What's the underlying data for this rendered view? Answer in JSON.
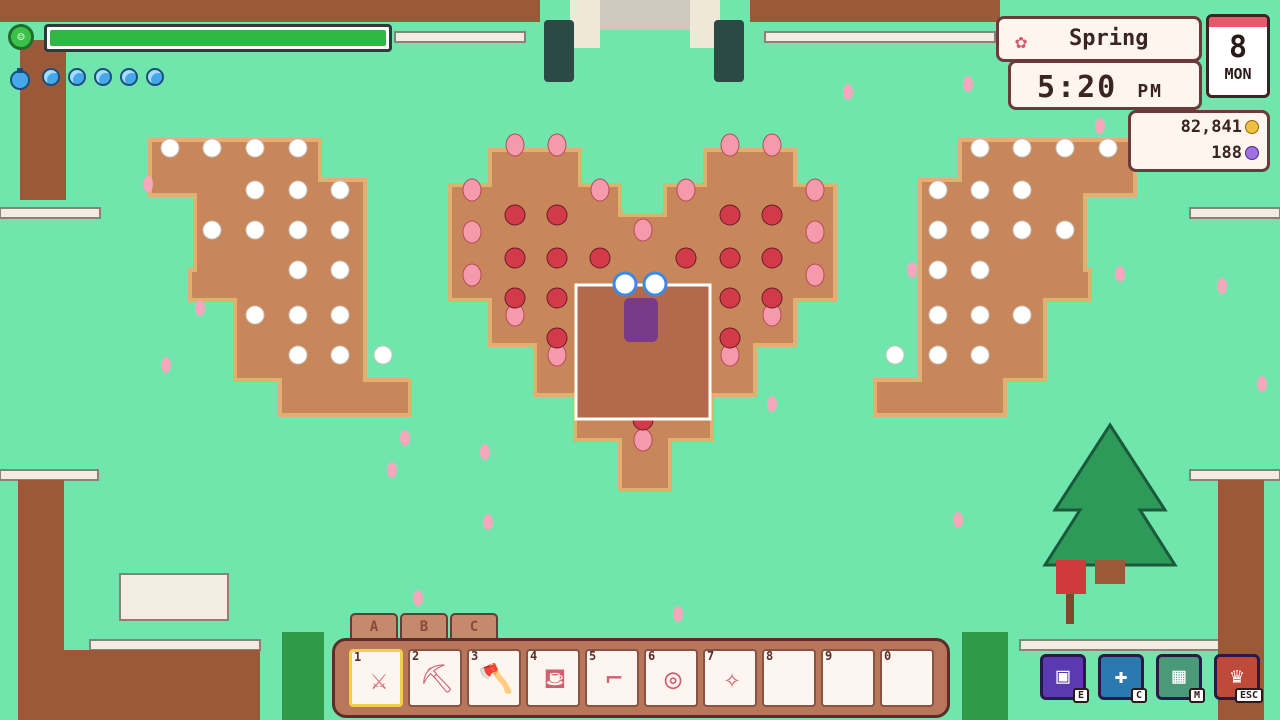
{
  "status": {
    "health_fraction": 1.0,
    "mana_orbs_filled": 5,
    "mana_orbs_total": 5
  },
  "clock": {
    "season": "Spring",
    "time": "5:20",
    "ampm": "PM",
    "day_number": "8",
    "day_of_week": "MON"
  },
  "currency": {
    "gold": "82,841",
    "gems": "188"
  },
  "hotbar": {
    "tabs": [
      "A",
      "B",
      "C"
    ],
    "selected_slot": 1,
    "slots": [
      {
        "num": "1",
        "icon": "sword-icon"
      },
      {
        "num": "2",
        "icon": "pickaxe-icon"
      },
      {
        "num": "3",
        "icon": "axe-icon"
      },
      {
        "num": "4",
        "icon": "watering-can-icon"
      },
      {
        "num": "5",
        "icon": "hoe-icon"
      },
      {
        "num": "6",
        "icon": "net-icon"
      },
      {
        "num": "7",
        "icon": "wand-icon"
      },
      {
        "num": "8",
        "icon": ""
      },
      {
        "num": "9",
        "icon": ""
      },
      {
        "num": "0",
        "icon": ""
      }
    ]
  },
  "menu": [
    {
      "name": "inventory-menu-button",
      "key": "E",
      "color": "#5a3ab0"
    },
    {
      "name": "crafting-menu-button",
      "key": "C",
      "color": "#2a7ab0"
    },
    {
      "name": "map-menu-button",
      "key": "M",
      "color": "#4a9a7a"
    },
    {
      "name": "main-menu-button",
      "key": "ESC",
      "color": "#c04a3a"
    }
  ],
  "colors": {
    "grass": "#70e6ac",
    "soil": "#c8875a",
    "soil_edge": "#e0b070",
    "hp_green": "#2fb844",
    "accent_pink": "#e45a6a"
  }
}
